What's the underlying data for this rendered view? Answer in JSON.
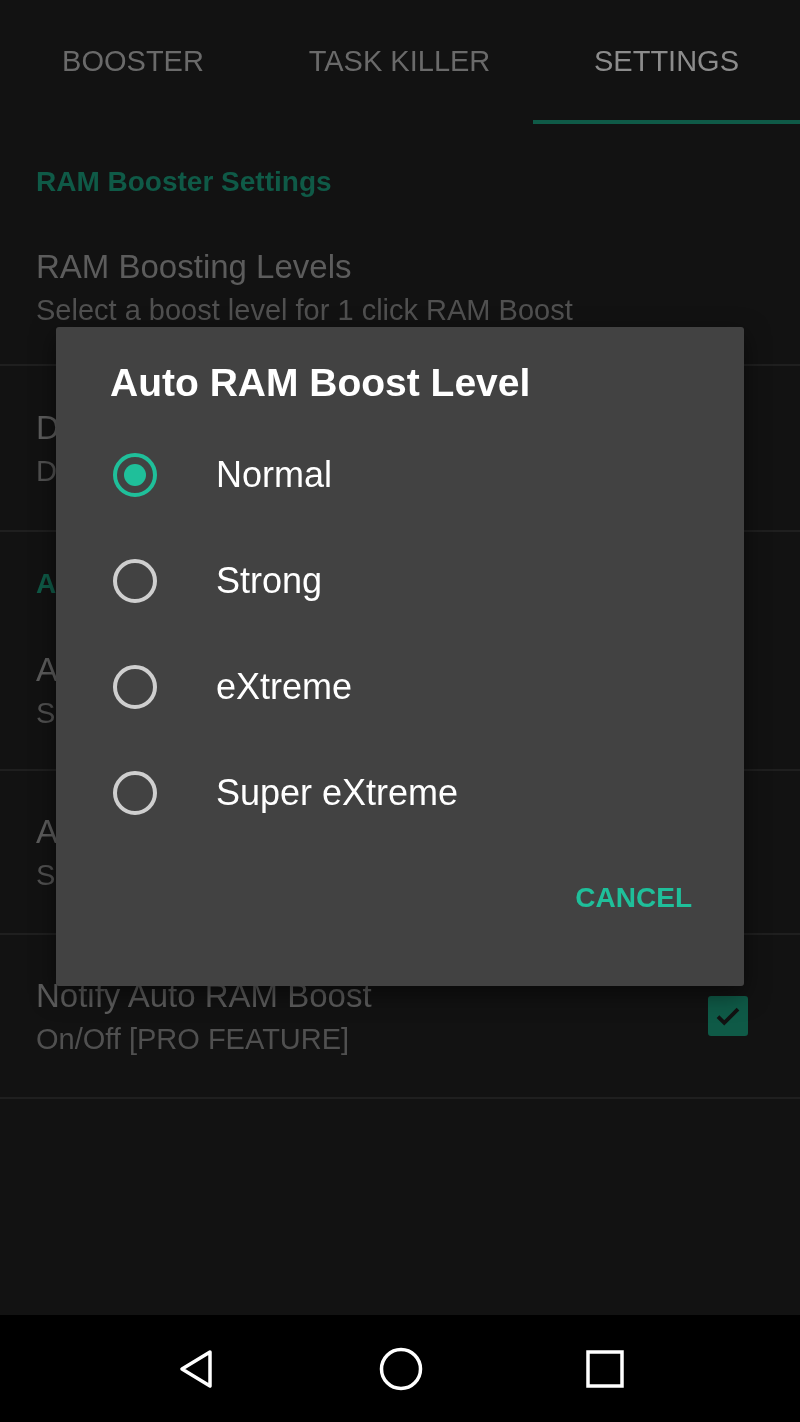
{
  "tabs": [
    {
      "label": "BOOSTER",
      "selected": false
    },
    {
      "label": "TASK KILLER",
      "selected": false
    },
    {
      "label": "SETTINGS",
      "selected": true
    }
  ],
  "settings": [
    {
      "kind": "header",
      "title": "RAM Booster Settings"
    },
    {
      "kind": "item",
      "title": "RAM Boosting Levels",
      "subtitle": "Select a boost level for 1 click RAM Boost"
    },
    {
      "kind": "item",
      "title": "D",
      "subtitle": "D"
    },
    {
      "kind": "header",
      "title": "A"
    },
    {
      "kind": "item",
      "title": "A",
      "subtitle": "S"
    },
    {
      "kind": "item",
      "title": "A",
      "subtitle": "S"
    },
    {
      "kind": "check",
      "title": "Notify Auto RAM Boost",
      "subtitle": "On/Off [PRO FEATURE]",
      "checked": true
    }
  ],
  "dialog": {
    "title": "Auto RAM Boost Level",
    "options": [
      {
        "label": "Normal",
        "selected": true
      },
      {
        "label": "Strong",
        "selected": false
      },
      {
        "label": "eXtreme",
        "selected": false
      },
      {
        "label": "Super eXtreme",
        "selected": false
      }
    ],
    "buttons": [
      "CANCEL"
    ]
  }
}
